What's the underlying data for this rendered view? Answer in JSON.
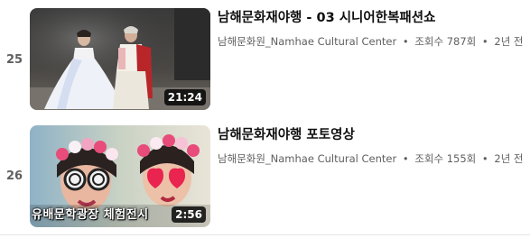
{
  "items": [
    {
      "index": "25",
      "title": "남해문화재야행 - 03 시니어한복패션쇼",
      "channel": "남해문화원_Namhae Cultural Center",
      "views": "조회수 787회",
      "age": "2년 전",
      "duration": "21:24",
      "thumbnail": "thumbnail-hanbok-fashion-show"
    },
    {
      "index": "26",
      "title": "남해문화재야행 포토영상",
      "channel": "남해문화원_Namhae Cultural Center",
      "views": "조회수 155회",
      "age": "2년 전",
      "duration": "2:56",
      "caption": "유배문학광장 체험전시",
      "thumbnail": "thumbnail-flower-crown-photo"
    }
  ],
  "separator": "•",
  "colors": {
    "title": "#0f0f0f",
    "meta": "#606060",
    "duration_bg": "#000000"
  }
}
